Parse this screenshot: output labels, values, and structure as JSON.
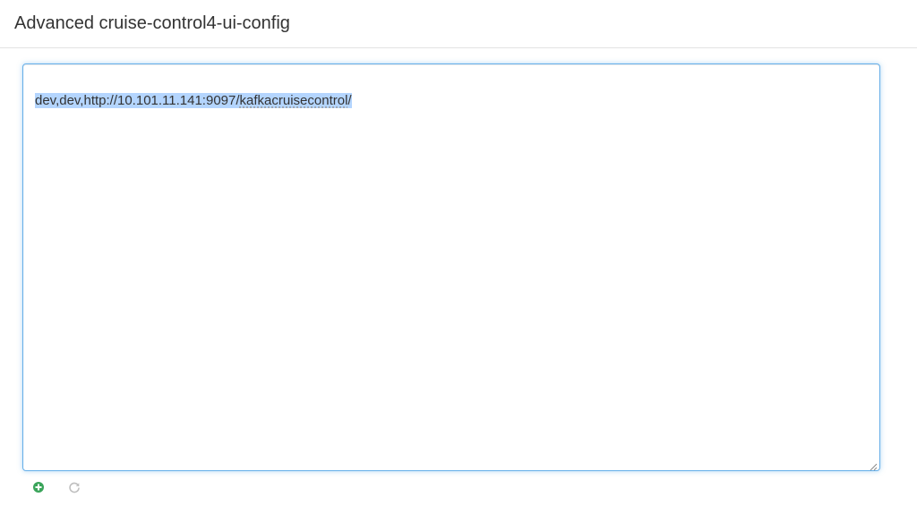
{
  "header": {
    "title": "Advanced cruise-control4-ui-config"
  },
  "editor": {
    "value_prefix": "dev,dev,http://10.101.11.141:9097/",
    "value_underlined": "kafkacruisecontrol",
    "value_suffix": "/"
  },
  "actions": {
    "add_icon": "plus-circle-icon",
    "reload_icon": "refresh-icon",
    "add_color": "#3aa45a",
    "reload_color": "#bfbfbf"
  },
  "colors": {
    "focus_border": "#66afe9",
    "selection": "#b4d5fe"
  }
}
